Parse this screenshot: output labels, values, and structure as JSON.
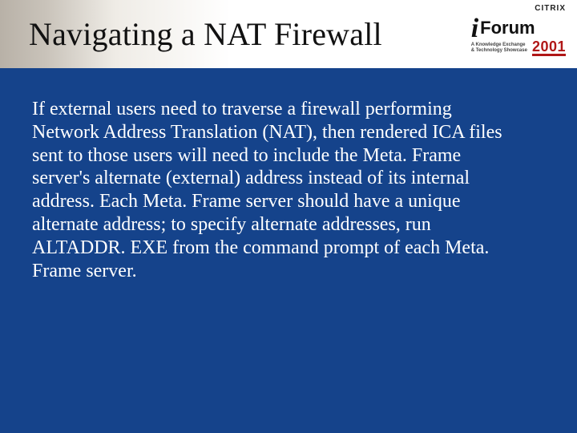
{
  "slide": {
    "title": "Navigating a NAT Firewall",
    "body": "If external users need to traverse a firewall performing Network Address Translation (NAT), then rendered ICA files sent to those users will need to include the Meta. Frame server's alternate (external) address instead of its internal address.  Each Meta. Frame server should have a unique alternate address; to specify alternate addresses, run ALTADDR. EXE from the command prompt of each Meta. Frame server."
  },
  "logo": {
    "brand_small": "CITRIX",
    "i": "i",
    "forum": "Forum",
    "tagline_line1": "A Knowledge Exchange",
    "tagline_line2": "& Technology Showcase",
    "year": "2001"
  }
}
